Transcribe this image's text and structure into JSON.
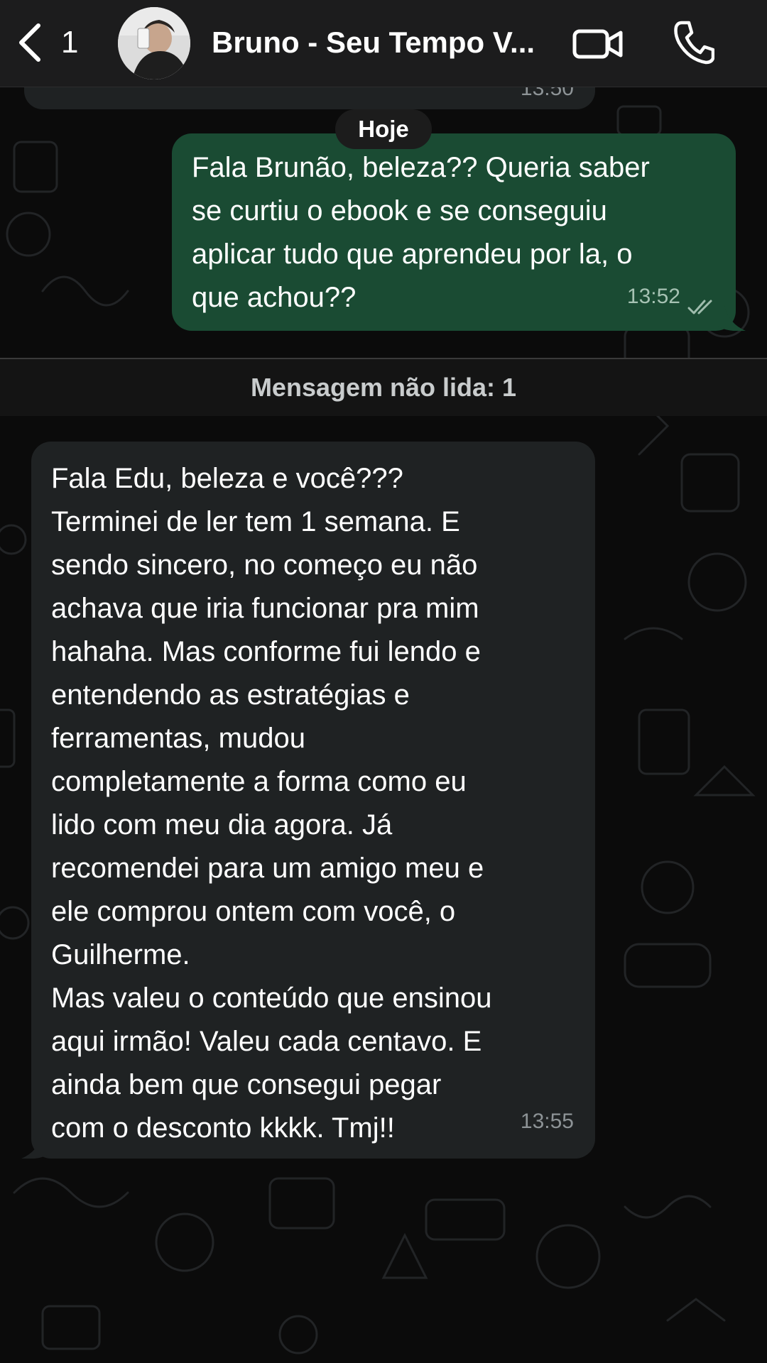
{
  "header": {
    "back_count": "1",
    "contact_name": "Bruno - Seu Tempo V...",
    "icons": {
      "back": "chevron-left-icon",
      "video": "video-camera-icon",
      "call": "phone-icon"
    }
  },
  "previous_message": {
    "time": "13:50"
  },
  "date_separator": "Hoje",
  "messages": [
    {
      "direction": "outgoing",
      "text": "Fala Brunão, beleza?? Queria saber\nse curtiu o ebook e se conseguiu\naplicar tudo que aprendeu por la, o\nque achou??",
      "time": "13:52",
      "status": "read"
    },
    {
      "direction": "incoming",
      "text": "Fala Edu, beleza e você???\nTerminei de ler tem 1 semana. E\nsendo sincero, no começo eu não\nachava que iria funcionar pra mim\nhahaha. Mas conforme fui lendo e\nentendendo as estratégias e\nferramentas, mudou\ncompletamente a forma como eu\nlido com meu dia agora. Já\nrecomendei para um amigo meu e\nele comprou ontem com você, o\nGuilherme.\nMas valeu o conteúdo que ensinou\naqui irmão! Valeu cada centavo. E\nainda bem que consegui pegar\ncom o desconto kkkk. Tmj!!",
      "time": "13:55"
    }
  ],
  "unread_banner": "Mensagem não lida: 1",
  "colors": {
    "background": "#0b0b0b",
    "outgoing_bubble": "#1a4b33",
    "incoming_bubble": "#1f2223",
    "header": "#1c1c1d"
  }
}
